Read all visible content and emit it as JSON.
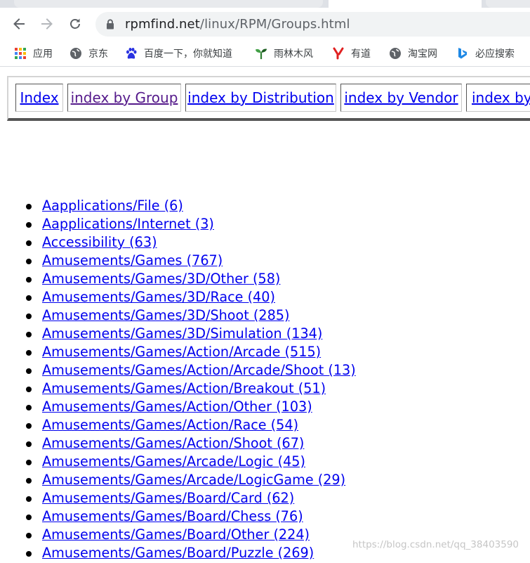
{
  "browser": {
    "url_host": "rpmfind.net",
    "url_path": "/linux/RPM/Groups.html"
  },
  "bookmarks": [
    {
      "label": "应用",
      "icon": "apps-grid-icon"
    },
    {
      "label": "京东",
      "icon": "globe-icon"
    },
    {
      "label": "百度一下，你就知道",
      "icon": "baidu-paw-icon"
    },
    {
      "label": "雨林木风",
      "icon": "tree-icon"
    },
    {
      "label": "有道",
      "icon": "youdao-icon"
    },
    {
      "label": "淘宝网",
      "icon": "globe-icon"
    },
    {
      "label": "必应搜索",
      "icon": "bing-icon"
    }
  ],
  "nav": [
    {
      "label": "Index"
    },
    {
      "label": "index by Group"
    },
    {
      "label": "index by Distribution"
    },
    {
      "label": "index by Vendor"
    },
    {
      "label": "index by"
    }
  ],
  "groups": [
    "Aapplications/File (6)",
    "Aapplications/Internet (3)",
    "Accessibility (63)",
    "Amusements/Games (767)",
    "Amusements/Games/3D/Other (58)",
    "Amusements/Games/3D/Race (40)",
    "Amusements/Games/3D/Shoot (285)",
    "Amusements/Games/3D/Simulation (134)",
    "Amusements/Games/Action/Arcade (515)",
    "Amusements/Games/Action/Arcade/Shoot (13)",
    "Amusements/Games/Action/Breakout (51)",
    "Amusements/Games/Action/Other (103)",
    "Amusements/Games/Action/Race (54)",
    "Amusements/Games/Action/Shoot (67)",
    "Amusements/Games/Arcade/Logic (45)",
    "Amusements/Games/Arcade/LogicGame (29)",
    "Amusements/Games/Board/Card (62)",
    "Amusements/Games/Board/Chess (76)",
    "Amusements/Games/Board/Other (224)",
    "Amusements/Games/Board/Puzzle (269)"
  ],
  "watermark": "https://blog.csdn.net/qq_38403590",
  "colors": {
    "link": "#0000ee",
    "visited": "#551a8b"
  }
}
